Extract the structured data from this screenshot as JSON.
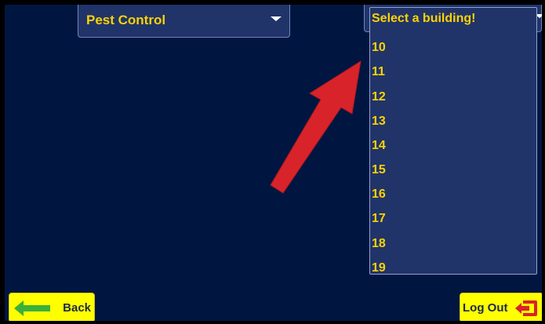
{
  "category_select": {
    "value": "Pest Control"
  },
  "building_select": {
    "placeholder": "Select a building!",
    "options": [
      "10",
      "11",
      "12",
      "13",
      "14",
      "15",
      "16",
      "17",
      "18",
      "19"
    ]
  },
  "buttons": {
    "back": "Back",
    "logout": "Log Out"
  },
  "icons": {
    "back": "left-arrow-icon",
    "logout": "exit-icon",
    "annotation": "red-arrow-icon"
  },
  "colors": {
    "background": "#001641",
    "accent_text": "#ffd200",
    "button": "#ffff00",
    "annotation_arrow": "#d9232a"
  }
}
